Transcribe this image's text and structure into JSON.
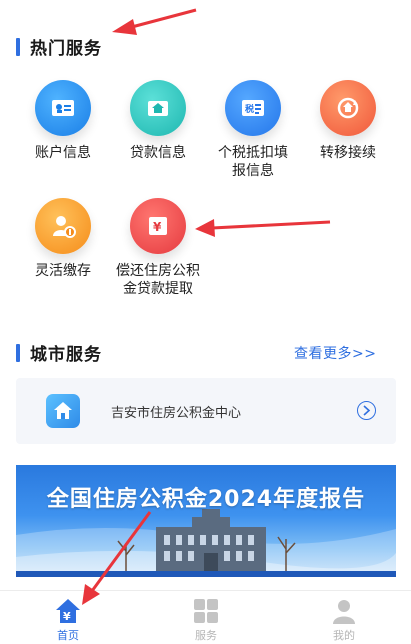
{
  "sections": {
    "hot_title": "热门服务",
    "city_title": "城市服务",
    "city_more": "查看更多>>"
  },
  "services": [
    {
      "label": "账户信息",
      "icon": "id-card-icon",
      "color": "#1a7ee6"
    },
    {
      "label": "贷款信息",
      "icon": "house-loan-icon",
      "color": "#1eb7b0"
    },
    {
      "label": "个税抵扣填报信息",
      "icon": "tax-form-icon",
      "color": "#2476ea"
    },
    {
      "label": "转移接续",
      "icon": "transfer-icon",
      "color": "#f0573a"
    },
    {
      "label": "灵活缴存",
      "icon": "flexible-deposit-icon",
      "color": "#f58c1a"
    },
    {
      "label": "偿还住房公积金贷款提取",
      "icon": "repay-withdraw-icon",
      "color": "#e53a3f"
    }
  ],
  "city_card": {
    "name": "吉安市住房公积金中心",
    "icon": "home-shield-icon"
  },
  "banner": {
    "title": "全国住房公积金2024年度报告"
  },
  "tabbar": [
    {
      "label": "首页",
      "icon": "home-yuan-icon",
      "active": true
    },
    {
      "label": "服务",
      "icon": "grid-icon",
      "active": false
    },
    {
      "label": "我的",
      "icon": "person-icon",
      "active": false
    }
  ],
  "accent_color": "#2f6fe0"
}
